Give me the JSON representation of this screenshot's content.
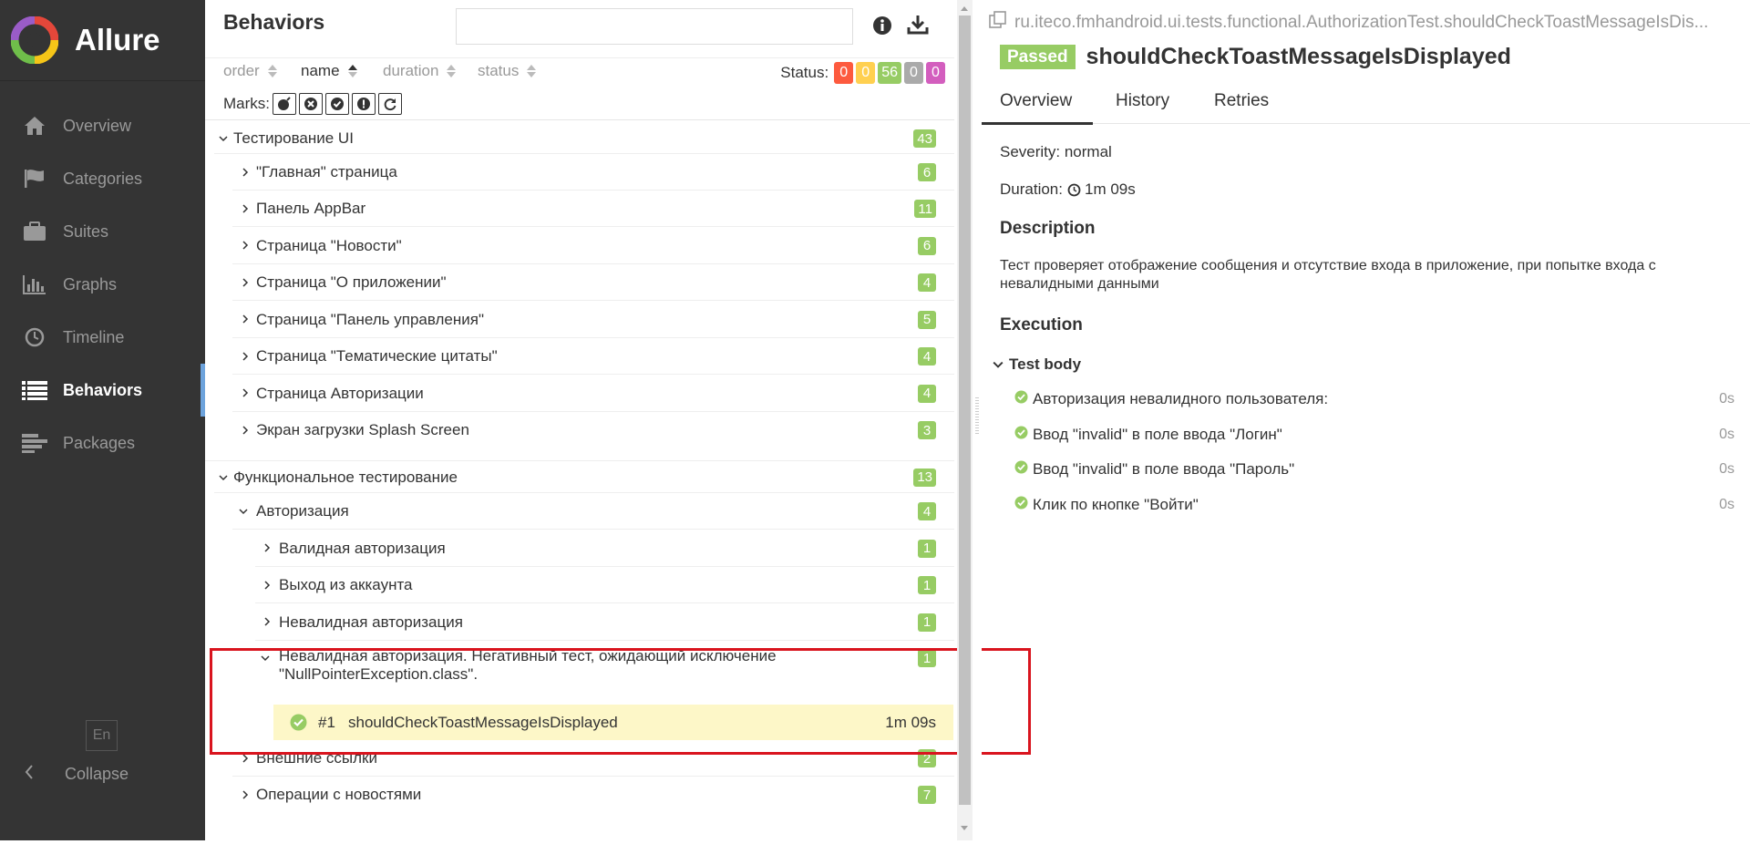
{
  "app": {
    "name": "Allure"
  },
  "sidebar": {
    "items": [
      {
        "label": "Overview",
        "icon": "home-icon"
      },
      {
        "label": "Categories",
        "icon": "flag-icon"
      },
      {
        "label": "Suites",
        "icon": "briefcase-icon"
      },
      {
        "label": "Graphs",
        "icon": "bar-chart-icon"
      },
      {
        "label": "Timeline",
        "icon": "clock-icon"
      },
      {
        "label": "Behaviors",
        "icon": "list-icon",
        "active": true
      },
      {
        "label": "Packages",
        "icon": "packages-icon"
      }
    ],
    "lang": "En",
    "collapse": "Collapse"
  },
  "behaviors": {
    "title": "Behaviors",
    "sort": {
      "order": "order",
      "name": "name",
      "duration": "duration",
      "status": "status"
    },
    "status_label": "Status:",
    "status_counts": [
      {
        "value": "0",
        "color": "#fd5a3e"
      },
      {
        "value": "0",
        "color": "#ffd050"
      },
      {
        "value": "56",
        "color": "#97cc64"
      },
      {
        "value": "0",
        "color": "#aaaaaa"
      },
      {
        "value": "0",
        "color": "#d35ebe"
      }
    ],
    "marks_label": "Marks:",
    "tree": [
      {
        "label": "Тестирование UI",
        "count": "43",
        "expanded": true
      },
      {
        "label": "\"Главная\" страница",
        "count": "6"
      },
      {
        "label": "Панель AppBar",
        "count": "11"
      },
      {
        "label": "Страница \"Новости\"",
        "count": "6"
      },
      {
        "label": "Страница \"О приложении\"",
        "count": "4"
      },
      {
        "label": "Страница \"Панель управления\"",
        "count": "5"
      },
      {
        "label": "Страница \"Тематические цитаты\"",
        "count": "4"
      },
      {
        "label": "Страница Авторизации",
        "count": "4"
      },
      {
        "label": "Экран загрузки Splash Screen",
        "count": "3"
      },
      {
        "label": "Функциональное тестирование",
        "count": "13",
        "expanded": true
      },
      {
        "label": "Авторизация",
        "count": "4",
        "expanded": true
      },
      {
        "label": "Валидная авторизация",
        "count": "1"
      },
      {
        "label": "Выход из аккаунта",
        "count": "1"
      },
      {
        "label": "Невалидная авторизация",
        "count": "1"
      },
      {
        "label": "Невалидная авторизация. Негативный тест, ожидающий исключение",
        "label2": "\"NullPointerException.class\".",
        "count": "1",
        "expanded": true
      },
      {
        "label": "Внешние ссылки",
        "count": "2"
      },
      {
        "label": "Операции с новостями",
        "count": "7"
      }
    ],
    "selected": {
      "num": "#1",
      "name": "shouldCheckToastMessageIsDisplayed",
      "duration": "1m 09s"
    }
  },
  "detail": {
    "path": "ru.iteco.fmhandroid.ui.tests.functional.AuthorizationTest.shouldCheckToastMessageIsDis...",
    "status": "Passed",
    "name": "shouldCheckToastMessageIsDisplayed",
    "tabs": [
      "Overview",
      "History",
      "Retries"
    ],
    "severity": "Severity: normal",
    "duration_label": "Duration:",
    "duration": "1m 09s",
    "description_title": "Description",
    "description": "Тест проверяет отображение сообщения и отсутствие входа в приложение, при попытке входа с невалидными данными",
    "execution_title": "Execution",
    "test_body": "Test body",
    "steps": [
      {
        "label": "Авторизация невалидного пользователя:",
        "time": "0s"
      },
      {
        "label": "Ввод \"invalid\" в поле ввода \"Логин\"",
        "time": "0s"
      },
      {
        "label": "Ввод \"invalid\" в поле ввода \"Пароль\"",
        "time": "0s"
      },
      {
        "label": "Клик по кнопке \"Войти\"",
        "time": "0s"
      }
    ],
    "colors": {
      "passed": "#97cc64",
      "highlight": "#d9141e"
    }
  }
}
